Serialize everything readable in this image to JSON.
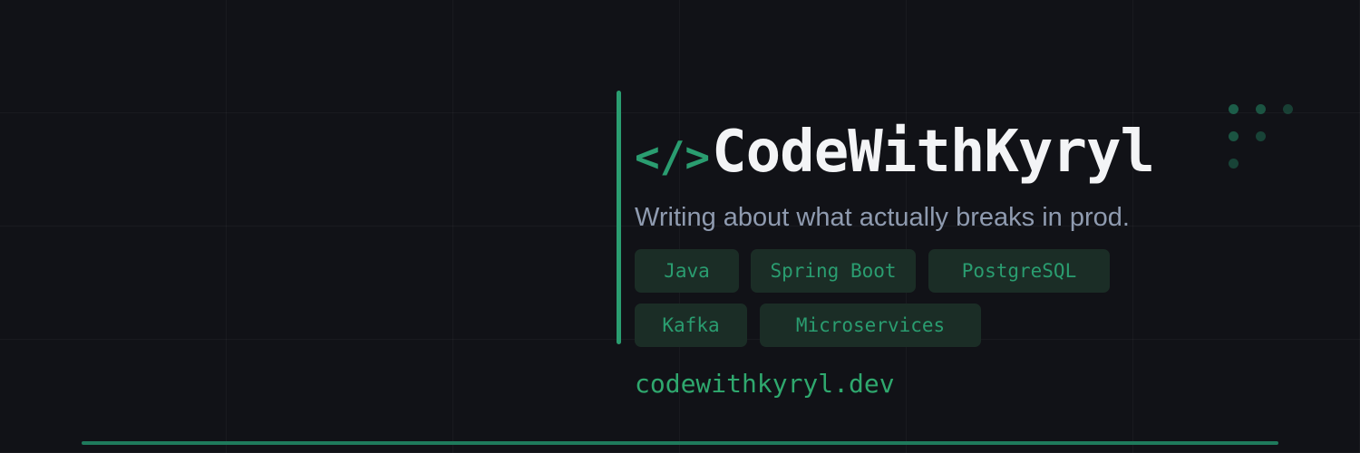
{
  "brand": {
    "prefix": "</>",
    "name": "CodeWithKyryl",
    "tagline": "Writing about what actually breaks in prod.",
    "url": "codewithkyryl.dev"
  },
  "tags": [
    "Java",
    "Spring Boot",
    "PostgreSQL",
    "Kafka",
    "Microservices"
  ],
  "decoration": {
    "dots_icon": "dot-grid-icon",
    "grid": true
  },
  "colors": {
    "background": "#111217",
    "accent": "#2a9d70",
    "title": "#f3f4f6",
    "tagline": "#8f9bb0",
    "tag_background": "#1b2d26",
    "url": "#2fa86e"
  }
}
